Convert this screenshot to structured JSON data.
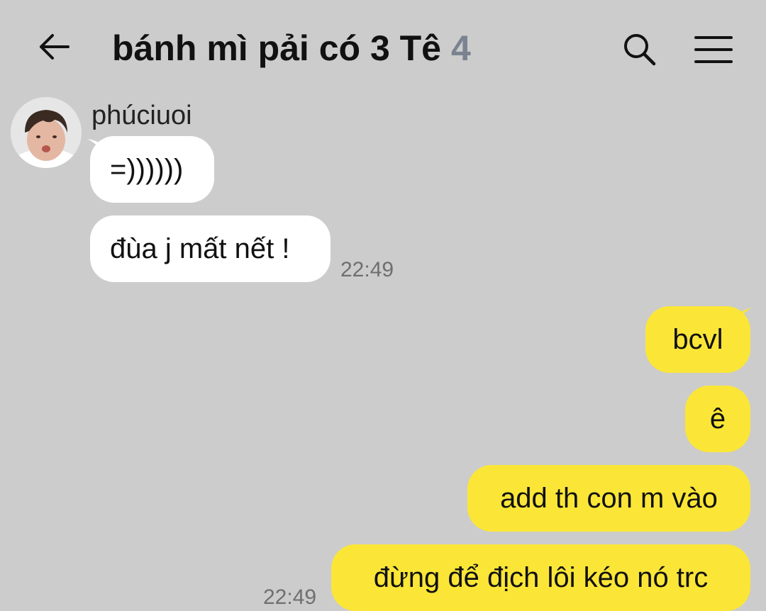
{
  "header": {
    "title": "bánh mì pải có 3 Tê",
    "member_count": "4",
    "back_icon": "arrow-left-icon",
    "search_icon": "search-icon",
    "menu_icon": "hamburger-menu-icon"
  },
  "colors": {
    "background": "#cccccc",
    "incoming_bubble": "#ffffff",
    "outgoing_bubble": "#fbe637",
    "count_text": "#7b8390",
    "timestamp_text": "#6f6f6f"
  },
  "incoming": {
    "sender_name": "phúciuoi",
    "messages": [
      {
        "text": "=))))))"
      },
      {
        "text": "đùa j mất nết !"
      }
    ],
    "time": "22:49"
  },
  "outgoing": {
    "messages": [
      {
        "text": "bcvl"
      },
      {
        "text": "ê"
      },
      {
        "text": "add th con m vào"
      },
      {
        "text": "đừng để địch lôi kéo nó trc"
      }
    ],
    "time": "22:49"
  }
}
